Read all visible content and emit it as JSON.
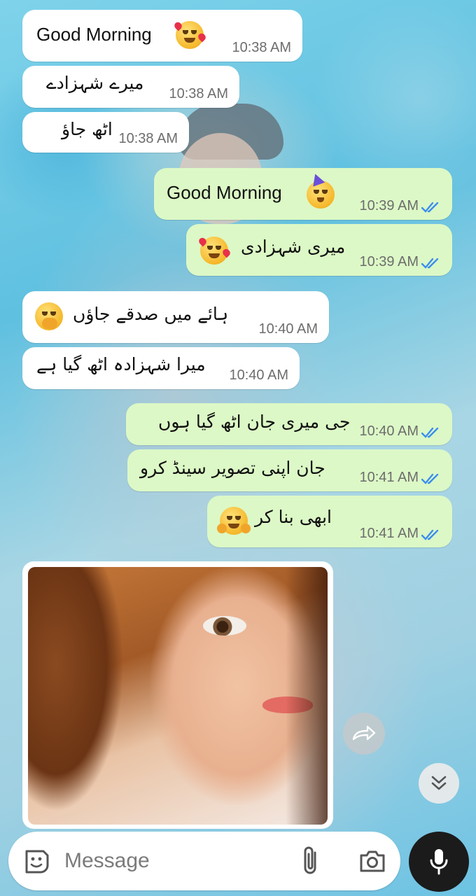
{
  "messages": [
    {
      "id": "m1",
      "direction": "incoming",
      "text": "Good Morning",
      "time": "10:38 AM",
      "emoji": "smiling-face-with-hearts"
    },
    {
      "id": "m2",
      "direction": "incoming",
      "text": "میرے شہزادے",
      "time": "10:38 AM"
    },
    {
      "id": "m3",
      "direction": "incoming",
      "text": "اٹھ جاؤ",
      "time": "10:38 AM"
    },
    {
      "id": "m4",
      "direction": "outgoing",
      "text": "Good Morning",
      "time": "10:39 AM",
      "emoji": "partying-face",
      "status": "read"
    },
    {
      "id": "m5",
      "direction": "outgoing",
      "text": "میری شہزادی",
      "time": "10:39 AM",
      "emoji": "smiling-face-with-hearts",
      "status": "read"
    },
    {
      "id": "m6",
      "direction": "incoming",
      "text": "ہائے میں صدقے جاؤں",
      "time": "10:40 AM",
      "emoji": "face-with-hand-over-mouth"
    },
    {
      "id": "m7",
      "direction": "incoming",
      "text": "میرا شہزادہ اٹھ گیا ہے",
      "time": "10:40 AM"
    },
    {
      "id": "m8",
      "direction": "outgoing",
      "text": "جی میری جان اٹھ گیا ہوں",
      "time": "10:40 AM",
      "status": "read"
    },
    {
      "id": "m9",
      "direction": "outgoing",
      "text": "جان اپنی تصویر سینڈ کرو",
      "time": "10:41 AM",
      "status": "read"
    },
    {
      "id": "m10",
      "direction": "outgoing",
      "text": "ابھی بنا کر",
      "time": "10:41 AM",
      "emoji": "hugging-face",
      "status": "read"
    },
    {
      "id": "m11",
      "direction": "incoming",
      "type": "image"
    }
  ],
  "controls": {
    "forward_icon": "forward-icon",
    "scroll_down_icon": "double-chevron-down-icon"
  },
  "composer": {
    "placeholder": "Message",
    "sticker_icon": "sticker-icon",
    "attach_icon": "paperclip-icon",
    "camera_icon": "camera-icon",
    "mic_icon": "microphone-icon"
  },
  "colors": {
    "incoming_bubble": "#ffffff",
    "outgoing_bubble": "#dcf8c6",
    "read_ticks": "#3b8ef0",
    "mic_button": "#1b1b1b"
  }
}
